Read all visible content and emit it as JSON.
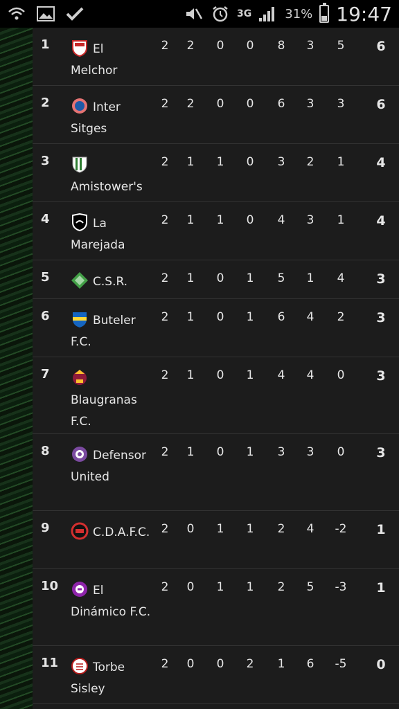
{
  "statusbar": {
    "icons": [
      "wifi-question-icon",
      "image-icon",
      "check-icon",
      "mute-icon",
      "alarm-icon"
    ],
    "network": "3G",
    "battery_percent": "31%",
    "battery_level": 0.31,
    "time": "19:47"
  },
  "standings": [
    {
      "pos": "1",
      "team": "El Melchor",
      "pj": "2",
      "pg": "2",
      "pe": "0",
      "pp": "0",
      "gf": "8",
      "gc": "3",
      "dg": "5",
      "pts": "6",
      "badge_colors": [
        "#c62828",
        "#ffffff"
      ]
    },
    {
      "pos": "2",
      "team": "Inter Sitges",
      "pj": "2",
      "pg": "2",
      "pe": "0",
      "pp": "0",
      "gf": "6",
      "gc": "3",
      "dg": "3",
      "pts": "6",
      "badge_colors": [
        "#1e5aa8",
        "#e57373"
      ]
    },
    {
      "pos": "3",
      "team": "Amistower's",
      "pj": "2",
      "pg": "1",
      "pe": "1",
      "pp": "0",
      "gf": "3",
      "gc": "2",
      "dg": "1",
      "pts": "4",
      "badge_colors": [
        "#ffffff",
        "#2e7d32"
      ]
    },
    {
      "pos": "4",
      "team": "La Marejada",
      "pj": "2",
      "pg": "1",
      "pe": "1",
      "pp": "0",
      "gf": "4",
      "gc": "3",
      "dg": "1",
      "pts": "4",
      "badge_colors": [
        "#000000",
        "#ffffff"
      ]
    },
    {
      "pos": "5",
      "team": "C.S.R.",
      "pj": "2",
      "pg": "1",
      "pe": "0",
      "pp": "1",
      "gf": "5",
      "gc": "1",
      "dg": "4",
      "pts": "3",
      "badge_colors": [
        "#43a047",
        "#a5d6a7"
      ]
    },
    {
      "pos": "6",
      "team": "Buteler F.C.",
      "pj": "2",
      "pg": "1",
      "pe": "0",
      "pp": "1",
      "gf": "6",
      "gc": "4",
      "dg": "2",
      "pts": "3",
      "badge_colors": [
        "#1565c0",
        "#fdd835"
      ]
    },
    {
      "pos": "7",
      "team": "Blaugranas F.C.",
      "pj": "2",
      "pg": "1",
      "pe": "0",
      "pp": "1",
      "gf": "4",
      "gc": "4",
      "dg": "0",
      "pts": "3",
      "badge_colors": [
        "#fbc02d",
        "#8e1b3a"
      ]
    },
    {
      "pos": "8",
      "team": "Defensor United",
      "pj": "2",
      "pg": "1",
      "pe": "0",
      "pp": "1",
      "gf": "3",
      "gc": "3",
      "dg": "0",
      "pts": "3",
      "badge_colors": [
        "#7b4aa0",
        "#ffffff"
      ]
    },
    {
      "pos": "9",
      "team": "C.D.A.F.C.",
      "pj": "2",
      "pg": "0",
      "pe": "1",
      "pp": "1",
      "gf": "2",
      "gc": "4",
      "dg": "-2",
      "pts": "1",
      "badge_colors": [
        "#d32f2f",
        "#111111"
      ]
    },
    {
      "pos": "10",
      "team": "El Dinámico F.C.",
      "pj": "2",
      "pg": "0",
      "pe": "1",
      "pp": "1",
      "gf": "2",
      "gc": "5",
      "dg": "-3",
      "pts": "1",
      "badge_colors": [
        "#8e24aa",
        "#ffffff"
      ]
    },
    {
      "pos": "11",
      "team": "Torbe Sisley",
      "pj": "2",
      "pg": "0",
      "pe": "0",
      "pp": "2",
      "gf": "1",
      "gc": "6",
      "dg": "-5",
      "pts": "0",
      "badge_colors": [
        "#ffffff",
        "#b71c1c"
      ]
    }
  ],
  "colors": {
    "panel_bg": "#1c1c1c",
    "divider": "#333333",
    "text": "#e6e6e6"
  }
}
